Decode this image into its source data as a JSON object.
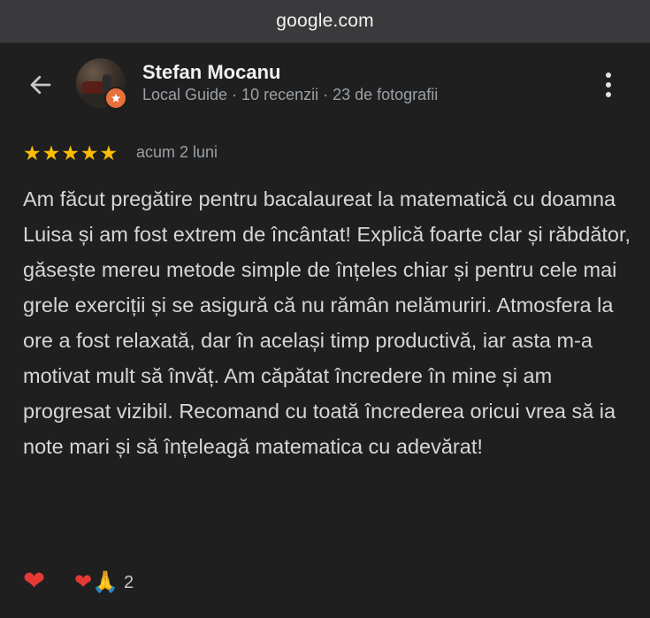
{
  "browser": {
    "url": "google.com"
  },
  "reviewer": {
    "name": "Stefan Mocanu",
    "meta": "Local Guide · 10 recenzii · 23 de fotografii"
  },
  "review": {
    "rating": 5,
    "stars": [
      "★",
      "★",
      "★",
      "★",
      "★"
    ],
    "time": "acum 2 luni",
    "text": "Am făcut pregătire pentru bacalaureat la matematică cu doamna Luisa și am fost extrem de încântat! Explică foarte clar și răbdător, găsește mereu metode simple de înțeles chiar și pentru cele mai grele exerciții și se asigură că nu rămân nelămuriri. Atmosfera la ore a fost relaxată, dar în același timp productivă, iar asta m-a motivat mult să învăț. Am căpătat încredere în mine și am progresat vizibil. Recomand cu toată încrederea oricui vrea să ia note mari și să înțeleagă matematica cu adevărat!"
  },
  "reactions": {
    "button_emoji": "❤",
    "summary_heart": "❤",
    "summary_pray": "🙏",
    "count": "2"
  },
  "icons": {
    "back": "back-arrow-icon",
    "more": "more-vert-icon",
    "local_guide_badge": "local-guide-badge-icon"
  },
  "colors": {
    "background": "#1f1f1f",
    "star": "#fbbc04",
    "badge": "#e8703a",
    "heart": "#e53935"
  }
}
